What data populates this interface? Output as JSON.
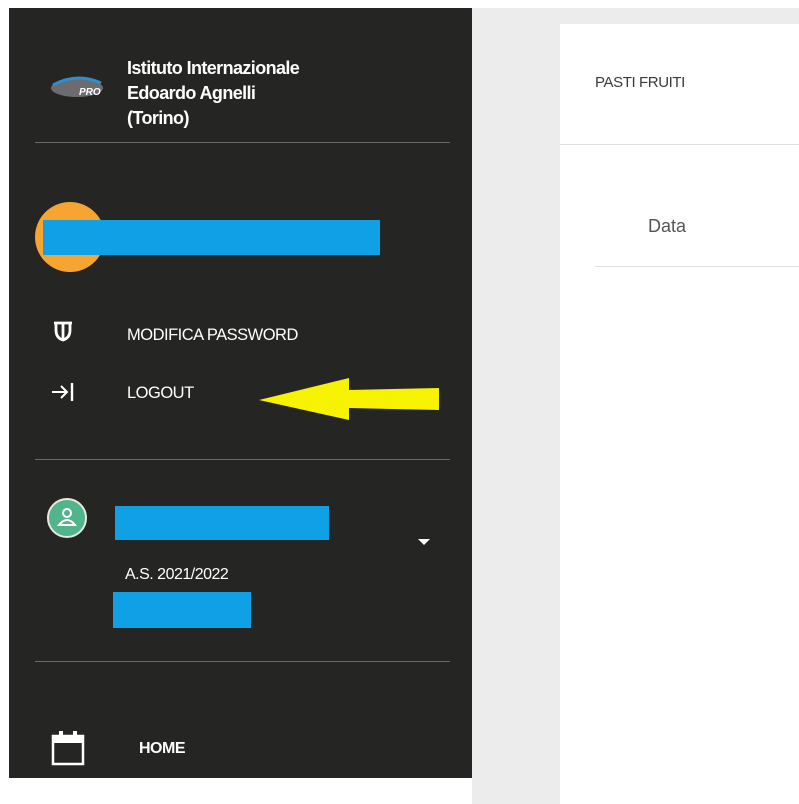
{
  "sidebar": {
    "school_name_lines": [
      "Istituto Internazionale",
      "Edoardo Agnelli",
      "(Torino)"
    ],
    "logo_text": "PRO",
    "menu": [
      {
        "label": "MODIFICA PASSWORD",
        "icon": "shield-icon"
      },
      {
        "label": "LOGOUT",
        "icon": "logout-icon"
      }
    ],
    "profile": {
      "school_year": "A.S. 2021/2022",
      "icon": "user-avatar-icon"
    },
    "nav": [
      {
        "label": "HOME",
        "icon": "calendar-icon"
      }
    ]
  },
  "main": {
    "card_title": "PASTI FRUITI",
    "table": {
      "columns": [
        "Data"
      ],
      "rows": []
    }
  },
  "colors": {
    "sidebar_bg": "#252523",
    "redaction": "#0fa0e6",
    "avatar_orange": "#f6a432",
    "avatar_green": "#52b48a",
    "annotation_arrow": "#f7f200"
  }
}
